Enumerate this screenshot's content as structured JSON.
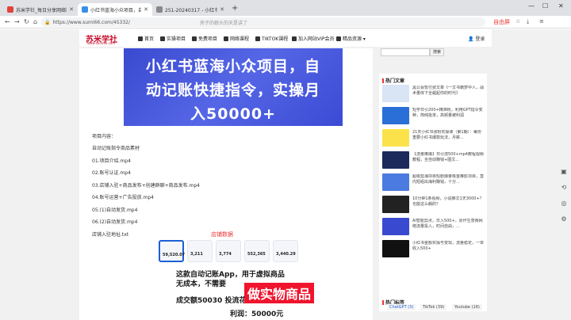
{
  "browser": {
    "tabs": [
      {
        "title": "苏米学社_每日分享网络赚钱",
        "color": "#e0433a",
        "active": false
      },
      {
        "title": "小红书蓝海小众项目，自动记",
        "color": "#3a8ee6",
        "active": true
      },
      {
        "title": "251-20240317 - 小红书蓝海",
        "color": "#888888",
        "active": false
      }
    ],
    "new_tab": "+",
    "url": "https://www.sumi66.com/45332/",
    "search_hint": "房子的娘头的天是讲了",
    "ext_label": "自由屏"
  },
  "site": {
    "logo": "苏米学社",
    "logo_sub": "www.sumi66.com",
    "nav": [
      "首页",
      "实操项目",
      "免费项目",
      "网络课程",
      "TIKTOK课程",
      "加入网站VIP会员",
      "精品资源"
    ],
    "login": "登录",
    "search_btn": "搜索"
  },
  "article": {
    "banner_lines": [
      "小红书蓝海小众项目，自",
      "动记账快捷指令，实操月",
      "入50000+"
    ],
    "body": [
      "项目内容：",
      "自动记账指令商品素材",
      "01.项目介绍.mp4",
      "02.账号认证.mp4",
      "03.店铺入驻+商品发布+创建群聊+商品发布.mp4",
      "04.账号运营+广告投放.mp4",
      "05.(1)自动发货.mp4",
      "06.(2)自动发货.mp4",
      "店铺入驻地址.txt"
    ],
    "shot_header": "店铺数据",
    "cards": [
      "59,520.07",
      "3,211",
      "3,774",
      "552,365",
      "3,440.29"
    ],
    "overlay1": "这款自动记账App，用于虚拟商品",
    "overlay2": "无成本，不需要",
    "overlay_big": "做实物商品",
    "overlay3": "成交额50030  投流花费9024",
    "overlay4": "利润：50000元"
  },
  "sidebar": {
    "hot_title": "热门文章",
    "articles": [
      {
        "text": "黑公会暂付费文章《一文书籍梦中人，战术量体下全崛起你的时代》",
        "color": "#d9e4f4"
      },
      {
        "text": "短学日引200+精准粉，利用GPT指令变种，简纯批单，高频量被利润",
        "color": "#2a6fd8"
      },
      {
        "text": "21天小红书涨粉实操课（第1期）：每份重要小红书爆款玩法，月薪...",
        "color": "#fbe24a"
      },
      {
        "text": "【流量推爆】日引流500+mp4教程视频教程，全自动赚钱+图文...",
        "color": "#1b2a5a"
      },
      {
        "text": "超级蓝海项目短剧爆量吸金推影项目，直内短组出海利赚钱，十分...",
        "color": "#4b7be0"
      },
      {
        "text": "10分钟1条视频，小说推文1天3000+？也能这么躺的？",
        "color": "#222222"
      },
      {
        "text": "AI智能剪点，日入500+，原作生意赛网络流量投入，时间自由，...",
        "color": "#3a4ad0"
      },
      {
        "text": "小红书金额实操号变现，流量稳定，一单收入500+",
        "color": "#111111"
      }
    ],
    "tags_title": "热门标签",
    "tags": [
      "ChatGPT (3)",
      "TikTok (39)",
      "Youtube (16)"
    ]
  }
}
